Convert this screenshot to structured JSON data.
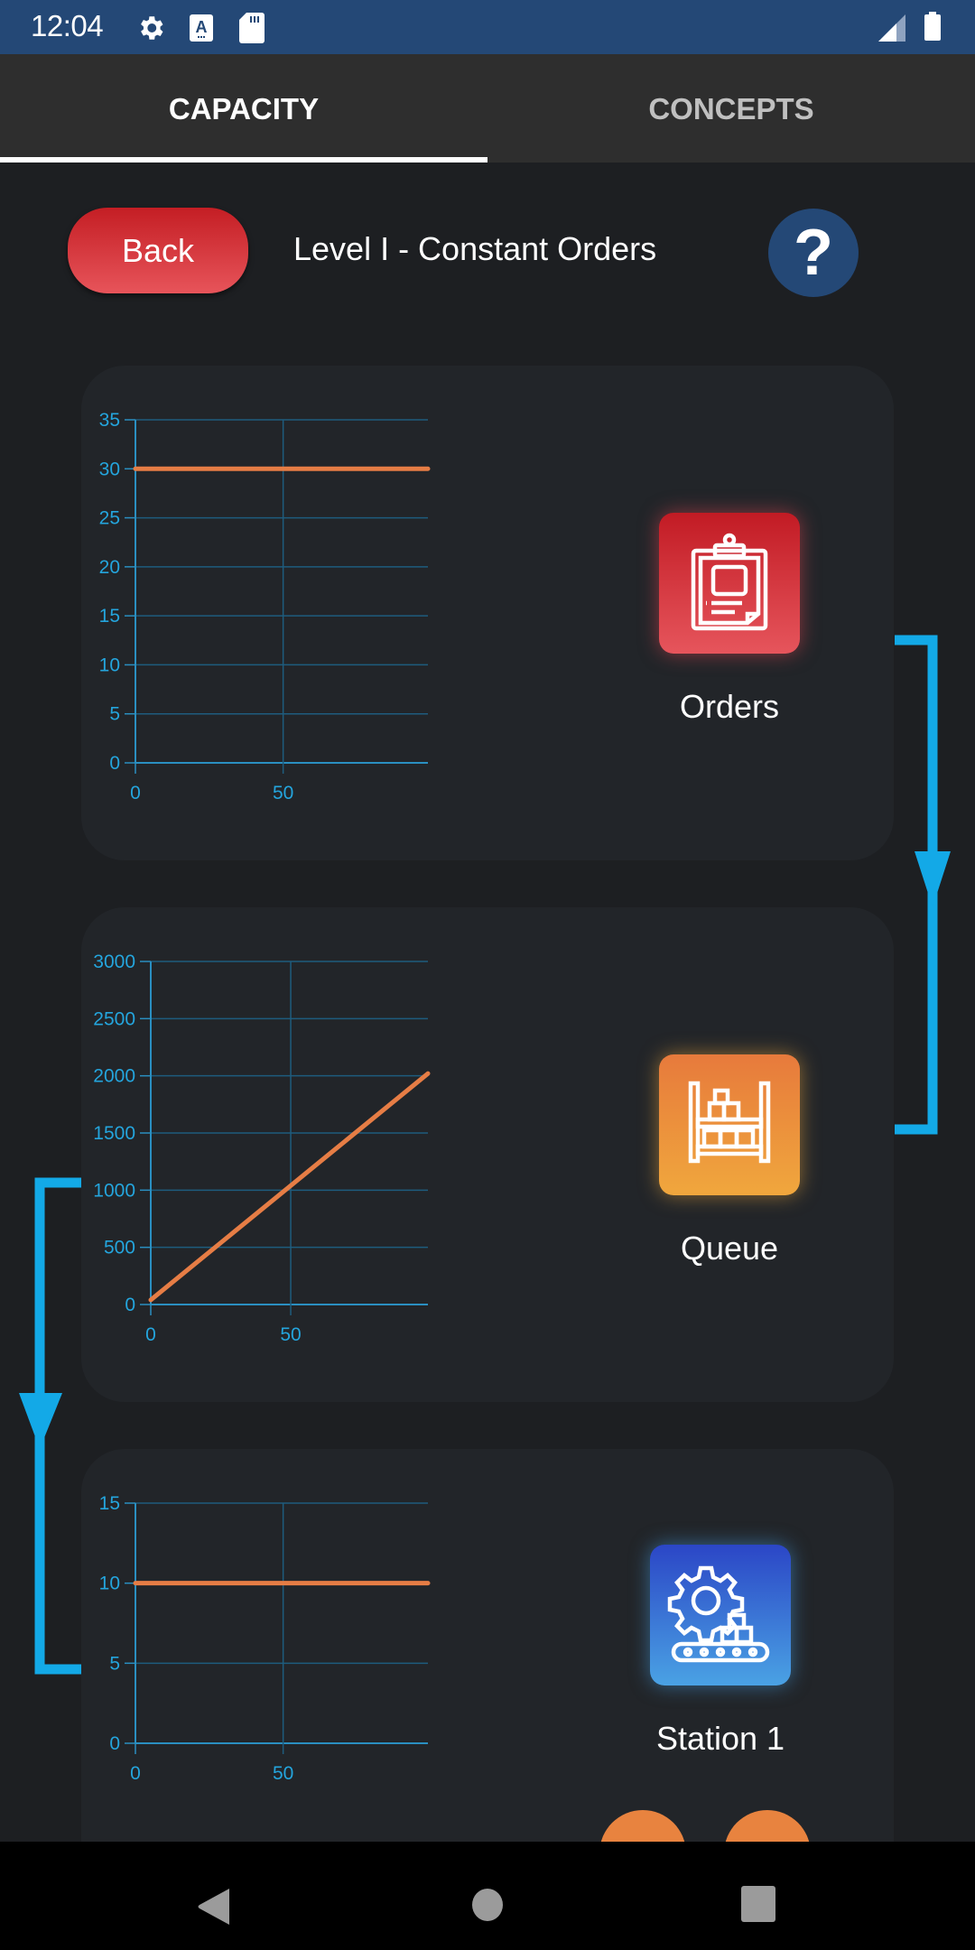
{
  "status_bar": {
    "time": "12:04",
    "icons": [
      "settings-icon",
      "a-keyboard-icon",
      "sd-card-icon",
      "signal-icon",
      "battery-icon"
    ]
  },
  "tabs": [
    {
      "label": "CAPACITY",
      "active": true
    },
    {
      "label": "CONCEPTS",
      "active": false
    }
  ],
  "header": {
    "back_label": "Back",
    "title": "Level I - Constant Orders",
    "help_label": "?"
  },
  "colors": {
    "accent_blue": "#13a9e7",
    "line_orange": "#e67d45",
    "axis_blue": "#24a5dd",
    "back_red": "#d2363d",
    "help_navy": "#244876"
  },
  "nodes": [
    {
      "label": "Orders",
      "icon": "clipboard-icon"
    },
    {
      "label": "Queue",
      "icon": "warehouse-shelf-icon"
    },
    {
      "label": "Station 1",
      "icon": "gear-conveyor-icon"
    }
  ],
  "chart_data": [
    {
      "type": "line",
      "title": "Orders",
      "xlabel": "",
      "ylabel": "",
      "xlim": [
        0,
        99
      ],
      "ylim": [
        0,
        35
      ],
      "xticks": [
        0,
        50
      ],
      "yticks": [
        0,
        5,
        10,
        15,
        20,
        25,
        30,
        35
      ],
      "grid": true,
      "series": [
        {
          "name": "Orders",
          "x": [
            0,
            99
          ],
          "y": [
            30,
            30
          ]
        }
      ]
    },
    {
      "type": "line",
      "title": "Queue",
      "xlabel": "",
      "ylabel": "",
      "xlim": [
        0,
        99
      ],
      "ylim": [
        0,
        3000
      ],
      "xticks": [
        0,
        50
      ],
      "yticks": [
        0,
        500,
        1000,
        1500,
        2000,
        2500,
        3000
      ],
      "grid": true,
      "series": [
        {
          "name": "Queue",
          "x": [
            0,
            50,
            99
          ],
          "y": [
            40,
            1040,
            2020
          ]
        }
      ]
    },
    {
      "type": "line",
      "title": "Station 1",
      "xlabel": "",
      "ylabel": "",
      "xlim": [
        0,
        99
      ],
      "ylim": [
        0,
        15
      ],
      "xticks": [
        0,
        50
      ],
      "yticks": [
        0,
        5,
        10,
        15
      ],
      "grid": true,
      "series": [
        {
          "name": "Station 1",
          "x": [
            0,
            99
          ],
          "y": [
            10,
            10
          ]
        }
      ]
    }
  ],
  "nav_bar": [
    "back-nav",
    "home-nav",
    "recents-nav"
  ]
}
